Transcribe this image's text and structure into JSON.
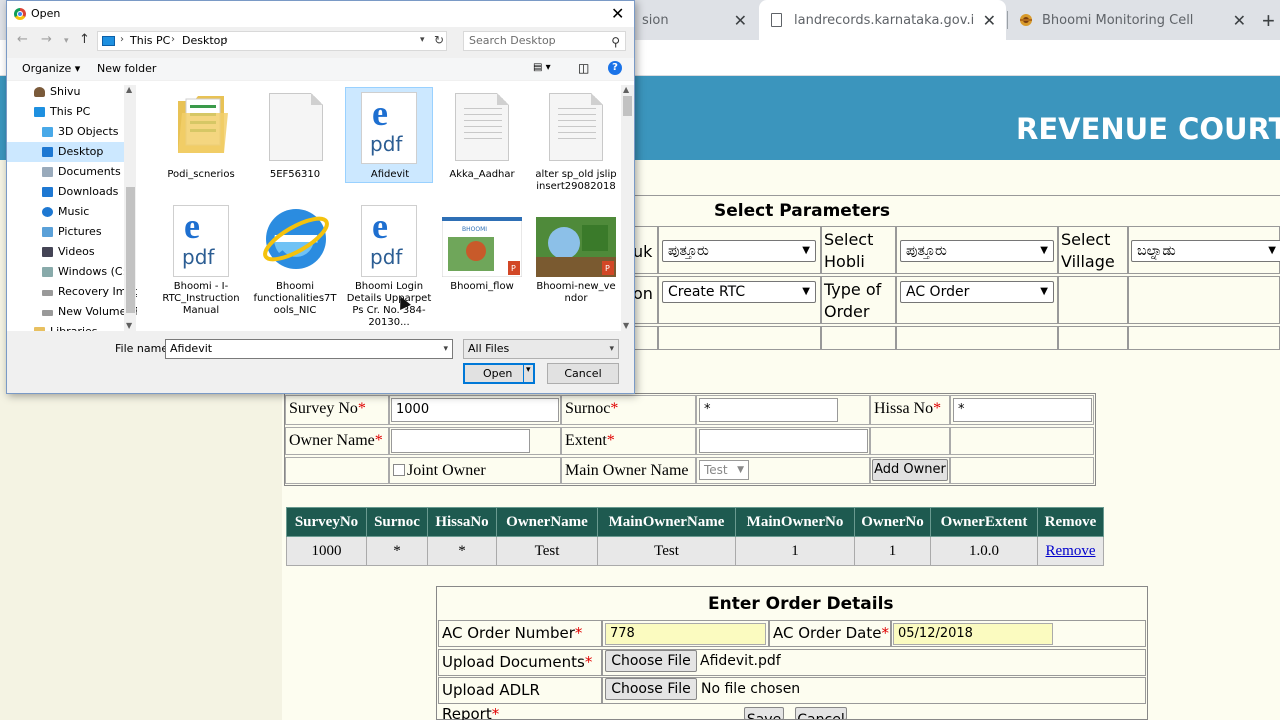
{
  "browser": {
    "tabs": [
      {
        "title": "sion"
      },
      {
        "title": "landrecords.karnataka.gov.in/RCT"
      },
      {
        "title": "Bhoomi Monitoring Cell"
      }
    ],
    "new_tab": "+"
  },
  "page": {
    "banner_title": "REVENUE COURT",
    "params": {
      "title": "Select Parameters",
      "taluk_label_fragment": "uk",
      "taluk_value": "ಪುತ್ತೂರು",
      "hobli_label": "Select Hobli",
      "hobli_value": "ಪುತ್ತೂರು",
      "village_label": "Select Village",
      "village_value": "ಬಲ್ನಾಡು",
      "type_label_fragment": "on",
      "rtc_value": "Create RTC",
      "order_type_label": "Type of Order",
      "order_type_value": "AC Order"
    },
    "form": {
      "survey_no_label": "Survey No",
      "survey_no_value": "1000",
      "surnoc_label": "Surnoc",
      "surnoc_value": "*",
      "hissa_no_label": "Hissa No",
      "hissa_no_value": "*",
      "owner_name_label": "Owner Name",
      "extent_label": "Extent",
      "joint_owner_label": "Joint Owner",
      "main_owner_name_label": "Main Owner Name",
      "main_owner_select": "Test",
      "add_owner_button": "Add Owner",
      "required_mark": "*"
    },
    "owners_table": {
      "headers": [
        "SurveyNo",
        "Surnoc",
        "HissaNo",
        "OwnerName",
        "MainOwnerName",
        "MainOwnerNo",
        "OwnerNo",
        "OwnerExtent",
        "Remove"
      ],
      "rows": [
        [
          "1000",
          "*",
          "*",
          "Test",
          "Test",
          "1",
          "1",
          "1.0.0",
          "Remove"
        ]
      ]
    },
    "order": {
      "title": "Enter Order Details",
      "ac_order_number_label": "AC Order Number",
      "ac_order_number_value": "778",
      "ac_order_date_label": "AC Order Date",
      "ac_order_date_value": "05/12/2018",
      "upload_documents_label": "Upload Documents",
      "upload_documents_file": "Afidevit.pdf",
      "upload_adlr_label": "Upload ADLR Report",
      "upload_adlr_file": "No file chosen",
      "choose_file": "Choose File",
      "save_button": "Save",
      "cancel_button": "Cancel"
    }
  },
  "dialog": {
    "title": "Open",
    "close": "✕",
    "breadcrumb": [
      "This PC",
      "Desktop"
    ],
    "search_placeholder": "Search Desktop",
    "organize": "Organize ▾",
    "new_folder": "New folder",
    "nav_items": [
      "Shivu",
      "This PC",
      "3D Objects",
      "Desktop",
      "Documents",
      "Downloads",
      "Music",
      "Pictures",
      "Videos",
      "Windows (C:)",
      "Recovery Imag",
      "New Volume (F",
      "Libraries"
    ],
    "selected_nav": "Desktop",
    "files": [
      {
        "name": "Podi_scnerios",
        "icon": "folder-icon"
      },
      {
        "name": "5EF56310",
        "icon": "blank-file-icon"
      },
      {
        "name": "Afidevit",
        "icon": "pdf-icon"
      },
      {
        "name": "Akka_Aadhar",
        "icon": "text-file-icon"
      },
      {
        "name": "alter sp_old jslip insert29082018",
        "icon": "text-file-icon"
      },
      {
        "name": "Bhoomi - I-RTC_Instruction Manual",
        "icon": "pdf-icon"
      },
      {
        "name": "Bhoomi functionalities7T ools_NIC",
        "icon": "ie-icon"
      },
      {
        "name": "Bhoomi Login Details Upparpet Ps Cr. No. 384-20130...",
        "icon": "pdf-icon"
      },
      {
        "name": "Bhoomi_flow",
        "icon": "pptx-icon"
      },
      {
        "name": "Bhoomi-new_ve ndor",
        "icon": "pptx-icon"
      }
    ],
    "selected_file": "Afidevit",
    "file_name_label": "File name:",
    "file_name_value": "Afidevit",
    "filter_value": "All Files",
    "open_button": "Open",
    "cancel_button": "Cancel"
  },
  "colors": {
    "banner": "#3b95bd",
    "table_header": "#1e5a50",
    "required": "#e00000",
    "dialog_selection": "#cce8ff"
  }
}
